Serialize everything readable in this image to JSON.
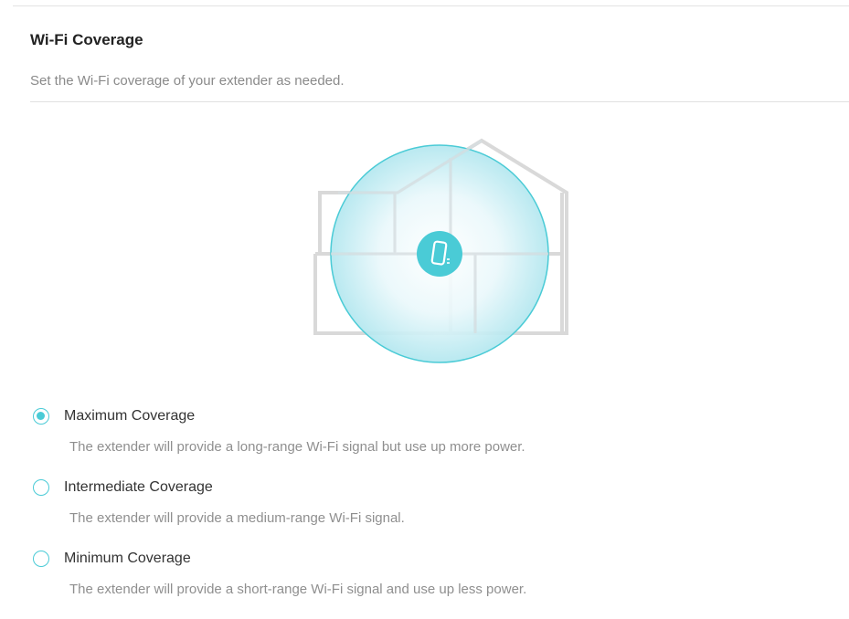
{
  "section": {
    "title": "Wi-Fi Coverage",
    "description": "Set the Wi-Fi coverage of your extender as needed."
  },
  "illustration": {
    "icon": "extender-device-icon",
    "accent_color": "#4acbd6",
    "house_color": "#d9d9d9"
  },
  "coverage_options": [
    {
      "label": "Maximum Coverage",
      "description": "The extender will provide a long-range Wi-Fi signal but use up more power.",
      "selected": true
    },
    {
      "label": "Intermediate Coverage",
      "description": "The extender will provide a medium-range Wi-Fi signal.",
      "selected": false
    },
    {
      "label": "Minimum Coverage",
      "description": "The extender will provide a short-range Wi-Fi signal and use up less power.",
      "selected": false
    }
  ]
}
